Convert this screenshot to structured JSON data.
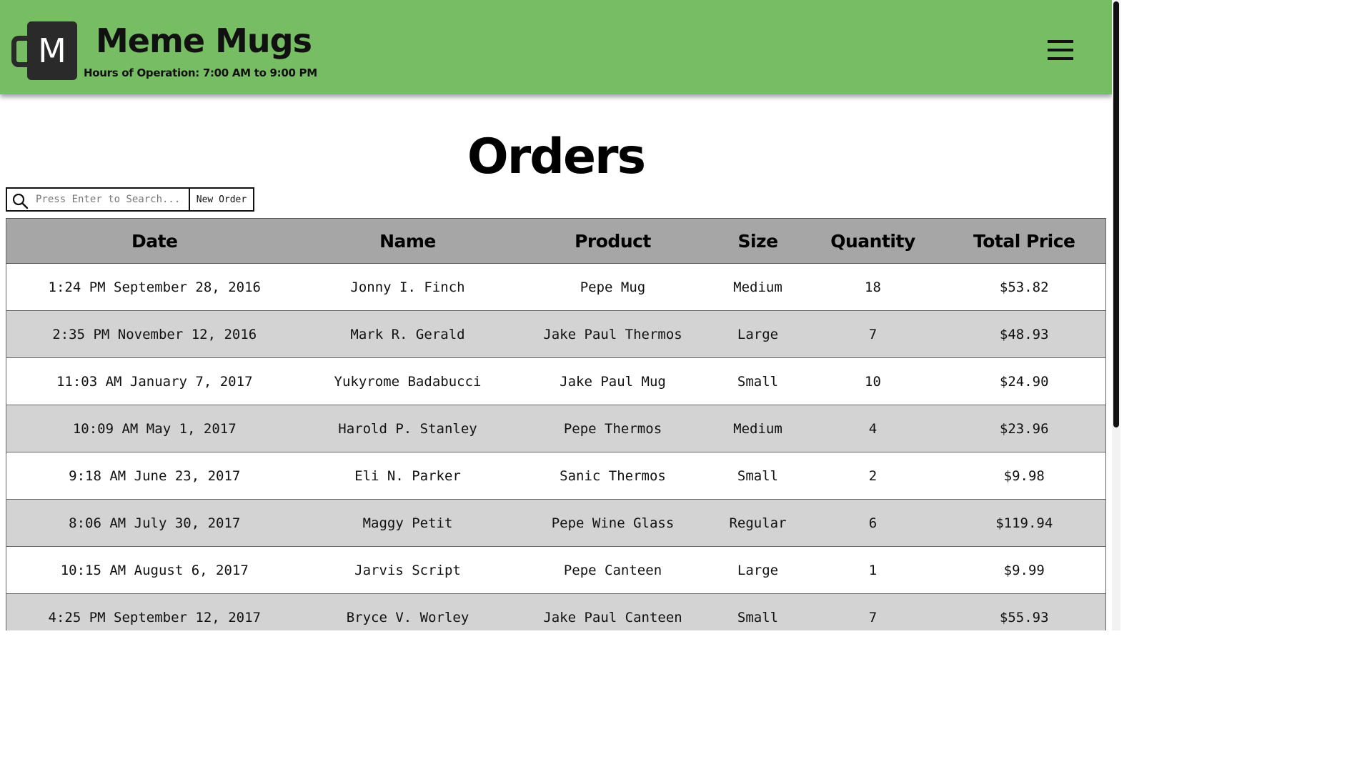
{
  "header": {
    "logo_letter": "M",
    "brand_title": "Meme Mugs",
    "hours": "Hours of Operation: 7:00 AM to 9:00 PM",
    "menu_icon": "hamburger-menu-icon",
    "background_color": "#77bd63"
  },
  "main": {
    "title": "Orders",
    "search": {
      "placeholder": "Press Enter to Search...",
      "value": "",
      "icon": "search-icon"
    },
    "new_order_label": "New Order"
  },
  "table": {
    "columns": [
      "Date",
      "Name",
      "Product",
      "Size",
      "Quantity",
      "Total Price"
    ],
    "rows": [
      {
        "date": "1:24 PM September 28, 2016",
        "name": "Jonny I. Finch",
        "product": "Pepe Mug",
        "size": "Medium",
        "quantity": "18",
        "total": "$53.82"
      },
      {
        "date": "2:35 PM November 12, 2016",
        "name": "Mark R. Gerald",
        "product": "Jake Paul Thermos",
        "size": "Large",
        "quantity": "7",
        "total": "$48.93"
      },
      {
        "date": "11:03 AM January 7, 2017",
        "name": "Yukyrome Badabucci",
        "product": "Jake Paul Mug",
        "size": "Small",
        "quantity": "10",
        "total": "$24.90"
      },
      {
        "date": "10:09 AM May 1, 2017",
        "name": "Harold P. Stanley",
        "product": "Pepe Thermos",
        "size": "Medium",
        "quantity": "4",
        "total": "$23.96"
      },
      {
        "date": "9:18 AM June 23, 2017",
        "name": "Eli N. Parker",
        "product": "Sanic Thermos",
        "size": "Small",
        "quantity": "2",
        "total": "$9.98"
      },
      {
        "date": "8:06 AM July 30, 2017",
        "name": "Maggy Petit",
        "product": "Pepe Wine Glass",
        "size": "Regular",
        "quantity": "6",
        "total": "$119.94"
      },
      {
        "date": "10:15 AM August 6, 2017",
        "name": "Jarvis Script",
        "product": "Pepe Canteen",
        "size": "Large",
        "quantity": "1",
        "total": "$9.99"
      },
      {
        "date": "4:25 PM September 12, 2017",
        "name": "Bryce V. Worley",
        "product": "Jake Paul Canteen",
        "size": "Small",
        "quantity": "7",
        "total": "$55.93"
      }
    ],
    "header_color": "#a6a6a6",
    "stripe_color": "#d3d3d3"
  }
}
